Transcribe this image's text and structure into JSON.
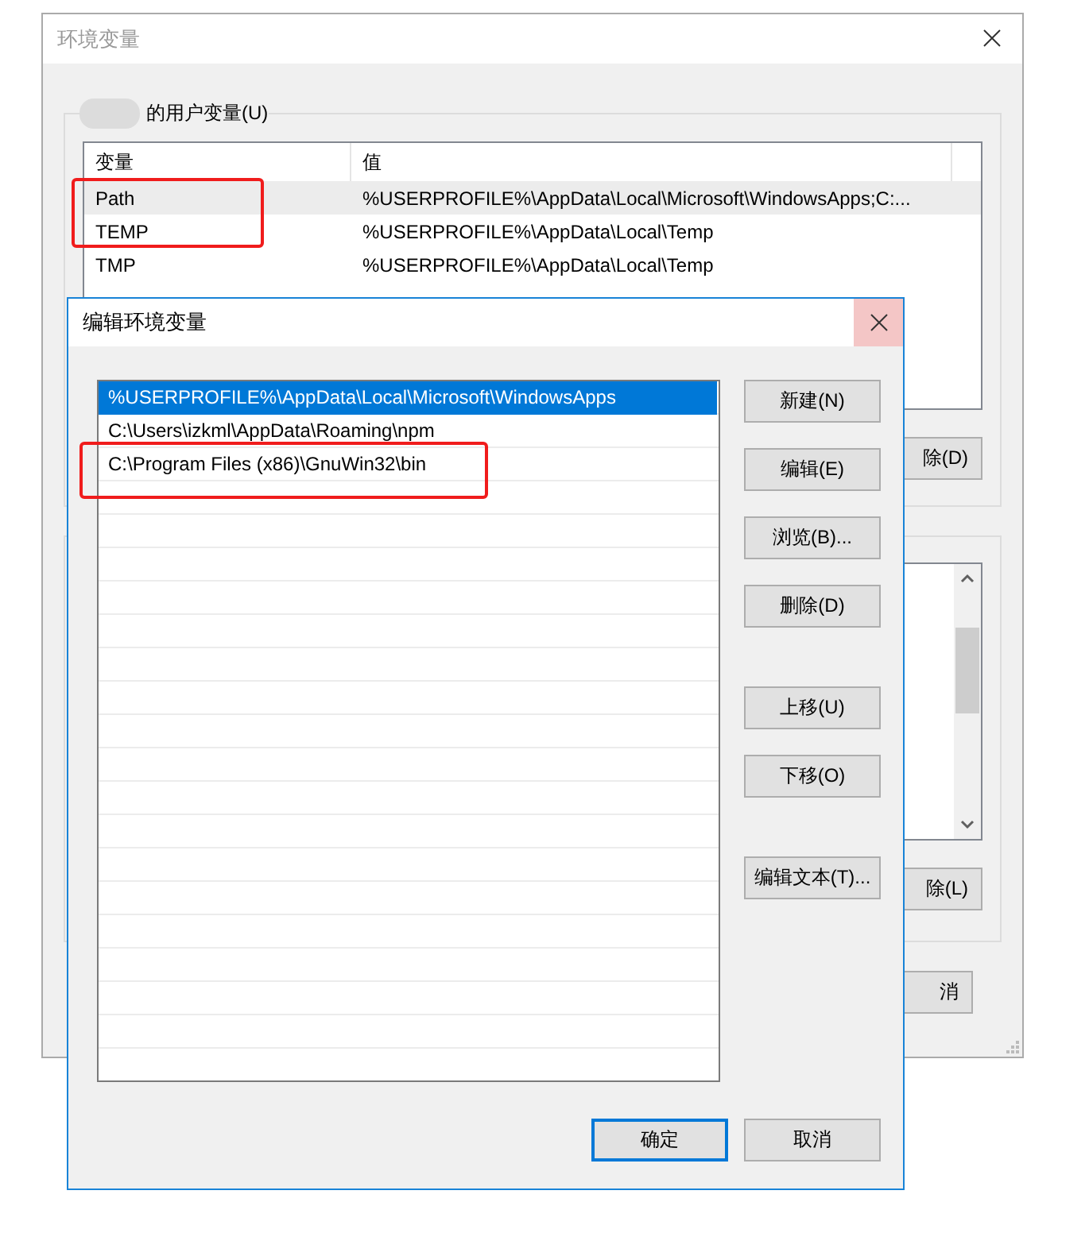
{
  "back_window": {
    "title": "环境变量",
    "group_label": "的用户变量(U)",
    "columns": [
      "变量",
      "值"
    ],
    "rows": [
      {
        "name": "Path",
        "value": "%USERPROFILE%\\AppData\\Local\\Microsoft\\WindowsApps;C:...",
        "selected": true
      },
      {
        "name": "TEMP",
        "value": "%USERPROFILE%\\AppData\\Local\\Temp",
        "selected": false
      },
      {
        "name": "TMP",
        "value": "%USERPROFILE%\\AppData\\Local\\Temp",
        "selected": false
      }
    ],
    "user_delete_button": "除(D)",
    "system_delete_button": "除(L)",
    "cancel_button": "消"
  },
  "dialog": {
    "title": "编辑环境变量",
    "entries": [
      {
        "text": "%USERPROFILE%\\AppData\\Local\\Microsoft\\WindowsApps",
        "selected": true
      },
      {
        "text": "C:\\Users\\izkml\\AppData\\Roaming\\npm",
        "selected": false
      },
      {
        "text": "C:\\Program Files (x86)\\GnuWin32\\bin",
        "selected": false
      }
    ],
    "button_groups": [
      [
        "新建(N)",
        "编辑(E)",
        "浏览(B)...",
        "删除(D)"
      ],
      [
        "上移(U)",
        "下移(O)"
      ],
      [
        "编辑文本(T)..."
      ]
    ],
    "footer_buttons": [
      {
        "label": "确定",
        "default": true
      },
      {
        "label": "取消",
        "default": false
      }
    ]
  }
}
